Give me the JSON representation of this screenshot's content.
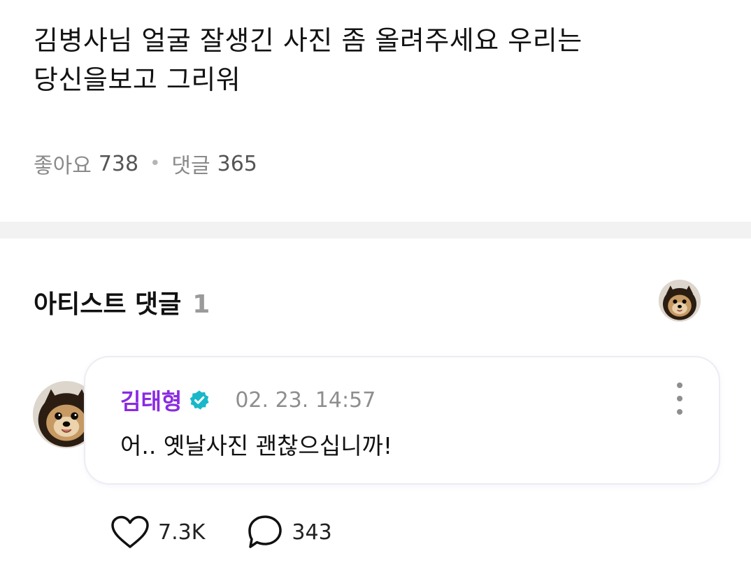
{
  "post": {
    "text_line1": "김병사님 얼굴 잘생긴 사진 좀 올려주세요 우리는",
    "text_line2": "당신을보고 그리워",
    "likes_label": "좋아요",
    "likes_count": "738",
    "comments_label": "댓글",
    "comments_count": "365"
  },
  "artist_comments": {
    "title": "아티스트 댓글",
    "count": "1"
  },
  "comment": {
    "author": "김태형",
    "timestamp": "02. 23. 14:57",
    "text": "어.. 옛날사진 괜찮으십니까!",
    "likes": "7.3K",
    "replies": "343"
  },
  "icons": {
    "verified": "verified-badge-icon",
    "more": "more-vertical-icon",
    "heart": "heart-icon",
    "reply": "speech-bubble-icon"
  },
  "colors": {
    "author_name": "#8a2be2",
    "verified_badge": "#18b8c9",
    "divider": "#f2f2f2"
  }
}
